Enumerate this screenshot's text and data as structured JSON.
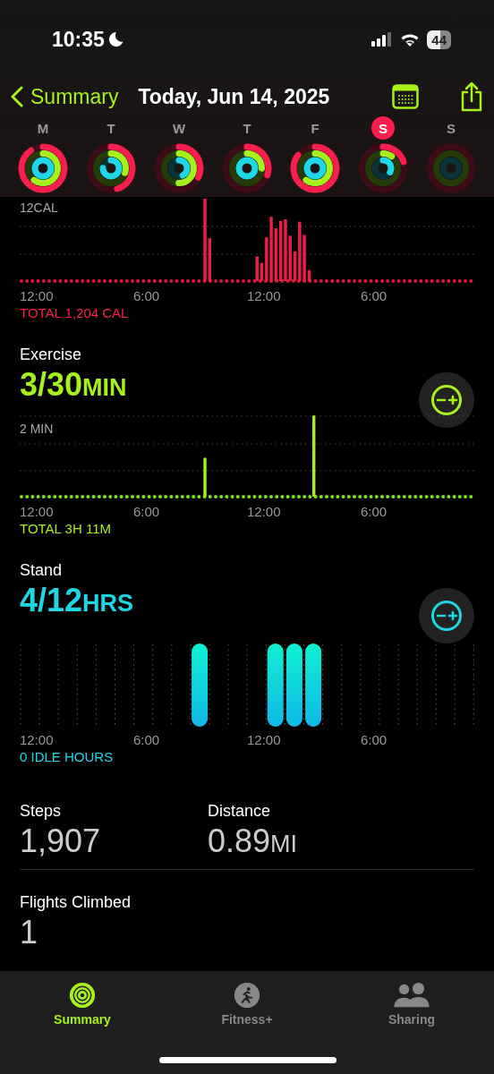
{
  "status_bar": {
    "time": "10:35",
    "battery": "44"
  },
  "nav": {
    "back": "Summary",
    "title": "Today, Jun 14, 2025"
  },
  "days": [
    {
      "label": "M",
      "selected": false
    },
    {
      "label": "T",
      "selected": false
    },
    {
      "label": "W",
      "selected": false
    },
    {
      "label": "T",
      "selected": false
    },
    {
      "label": "F",
      "selected": false
    },
    {
      "label": "S",
      "selected": true
    },
    {
      "label": "S",
      "selected": false
    }
  ],
  "sections": [
    {
      "kind": "move",
      "scale": "12CAL",
      "times": [
        "12:00",
        "6:00",
        "12:00",
        "6:00"
      ],
      "total": "TOTAL 1,204 CAL"
    },
    {
      "kind": "exercise",
      "title": "Exercise",
      "value": "3/30",
      "unit": "MIN",
      "scale": "2 MIN",
      "times": [
        "12:00",
        "6:00",
        "12:00",
        "6:00"
      ],
      "total": "TOTAL 3H 11M"
    },
    {
      "kind": "stand",
      "title": "Stand",
      "value": "4/12",
      "unit": "HRS",
      "times": [
        "12:00",
        "6:00",
        "12:00",
        "6:00"
      ],
      "total": "0 IDLE HOURS"
    }
  ],
  "stats": [
    [
      {
        "label": "Steps",
        "value": "1,907"
      },
      {
        "label": "Distance",
        "value": "0.89",
        "unit": "MI"
      }
    ],
    [
      {
        "label": "Flights Climbed",
        "value": "1"
      }
    ]
  ],
  "tabs": [
    {
      "label": "Summary",
      "selected": true
    },
    {
      "label": "Fitness+",
      "selected": false
    },
    {
      "label": "Sharing",
      "selected": false
    }
  ]
}
